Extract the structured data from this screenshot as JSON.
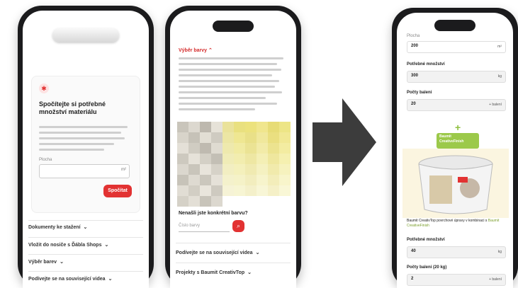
{
  "phone1": {
    "card_heading": "Spočítejte si potřebné množství materiálu",
    "field_label": "Plocha",
    "field_unit": "m²",
    "calc_button": "Spočítat",
    "accordion": [
      {
        "label": "Dokumenty ke stažení"
      },
      {
        "label": "Vložit do nosiče s Ďábla Shops"
      },
      {
        "label": "Výběr barev"
      },
      {
        "label": "Podívejte se na související videa"
      }
    ]
  },
  "phone2": {
    "section_title": "Výběr barvy",
    "search_question": "Nenašli jste konkrétní barvu?",
    "search_placeholder": "Číslo barvy",
    "accordion": [
      {
        "label": "Podívejte se na související videa"
      },
      {
        "label": "Projekty s Baumit CreativTop"
      }
    ],
    "swatch_colors": [
      "#c9c5bb",
      "#dcd8cf",
      "#bdb8ae",
      "#e6e2d8",
      "#eae29a",
      "#e9e07f",
      "#ece27d",
      "#f0e68d",
      "#e7dc76",
      "#ede586",
      "#d8d4ca",
      "#c6c2b8",
      "#e2ded4",
      "#cfcbc1",
      "#ece6a4",
      "#efe792",
      "#e9e088",
      "#f0e89c",
      "#eadf80",
      "#f1e894",
      "#e4e0d7",
      "#d0ccc2",
      "#bfbab0",
      "#dfdbd1",
      "#eee9ad",
      "#f1eba2",
      "#ebe394",
      "#f2eba8",
      "#ece38f",
      "#f3eca1",
      "#cdc9bf",
      "#e6e2d9",
      "#d4d0c6",
      "#c3bfb5",
      "#f0ecb7",
      "#f2edaf",
      "#eee7a3",
      "#f4efb5",
      "#efe79e",
      "#f5f0b0",
      "#dbd7ce",
      "#c9c5bb",
      "#e8e4db",
      "#d6d2c8",
      "#f2eec2",
      "#f4f0bc",
      "#f0eab1",
      "#f5f1c1",
      "#f1eaac",
      "#f6f2be",
      "#c7c3b9",
      "#dedad1",
      "#cbc7bd",
      "#e5e1d8",
      "#f4f1cc",
      "#f5f2c8",
      "#f2edbe",
      "#f7f4cc",
      "#f3edba",
      "#f8f5cb",
      "#e1ddd4",
      "#d2cec4",
      "#e9e5dc",
      "#cecac0",
      "#f6f3d6",
      "#f7f5d3",
      "#f4f0ca",
      "#f8f6d6",
      "#f5f0c7",
      "#f9f7d6",
      "#d5d1c7",
      "#e3dfd6",
      "#c8c4ba",
      "#dcd8cf",
      "#ffffff",
      "#ffffff",
      "#ffffff",
      "#ffffff",
      "#ffffff",
      "#ffffff"
    ]
  },
  "phone3": {
    "plocha_label": "Plocha",
    "plocha_value": "200",
    "plocha_unit": "m²",
    "need_label": "Potřebné množství",
    "need_value": "300",
    "need_unit": "kg",
    "buckets_label": "Počty balení",
    "buckets_value": "20",
    "buckets_unit": "+ balení",
    "badge_text": "Baumit CreativeFinish",
    "description_start": "Baumit CreativTop povrchové úpravy v kombinaci s",
    "description_highlight": "Baumit CreativeFinish",
    "need_label_2": "Potřebné množství",
    "need_value_2": "40",
    "need_unit_2": "kg",
    "buckets_label_2": "Počty balení (20 kg)",
    "buckets_value_2": "2",
    "buckets_unit_2": "+ balení"
  },
  "colors": {
    "accent_red": "#e23232",
    "accent_green": "#9cc94a",
    "phone_frame": "#1b1b1d"
  }
}
